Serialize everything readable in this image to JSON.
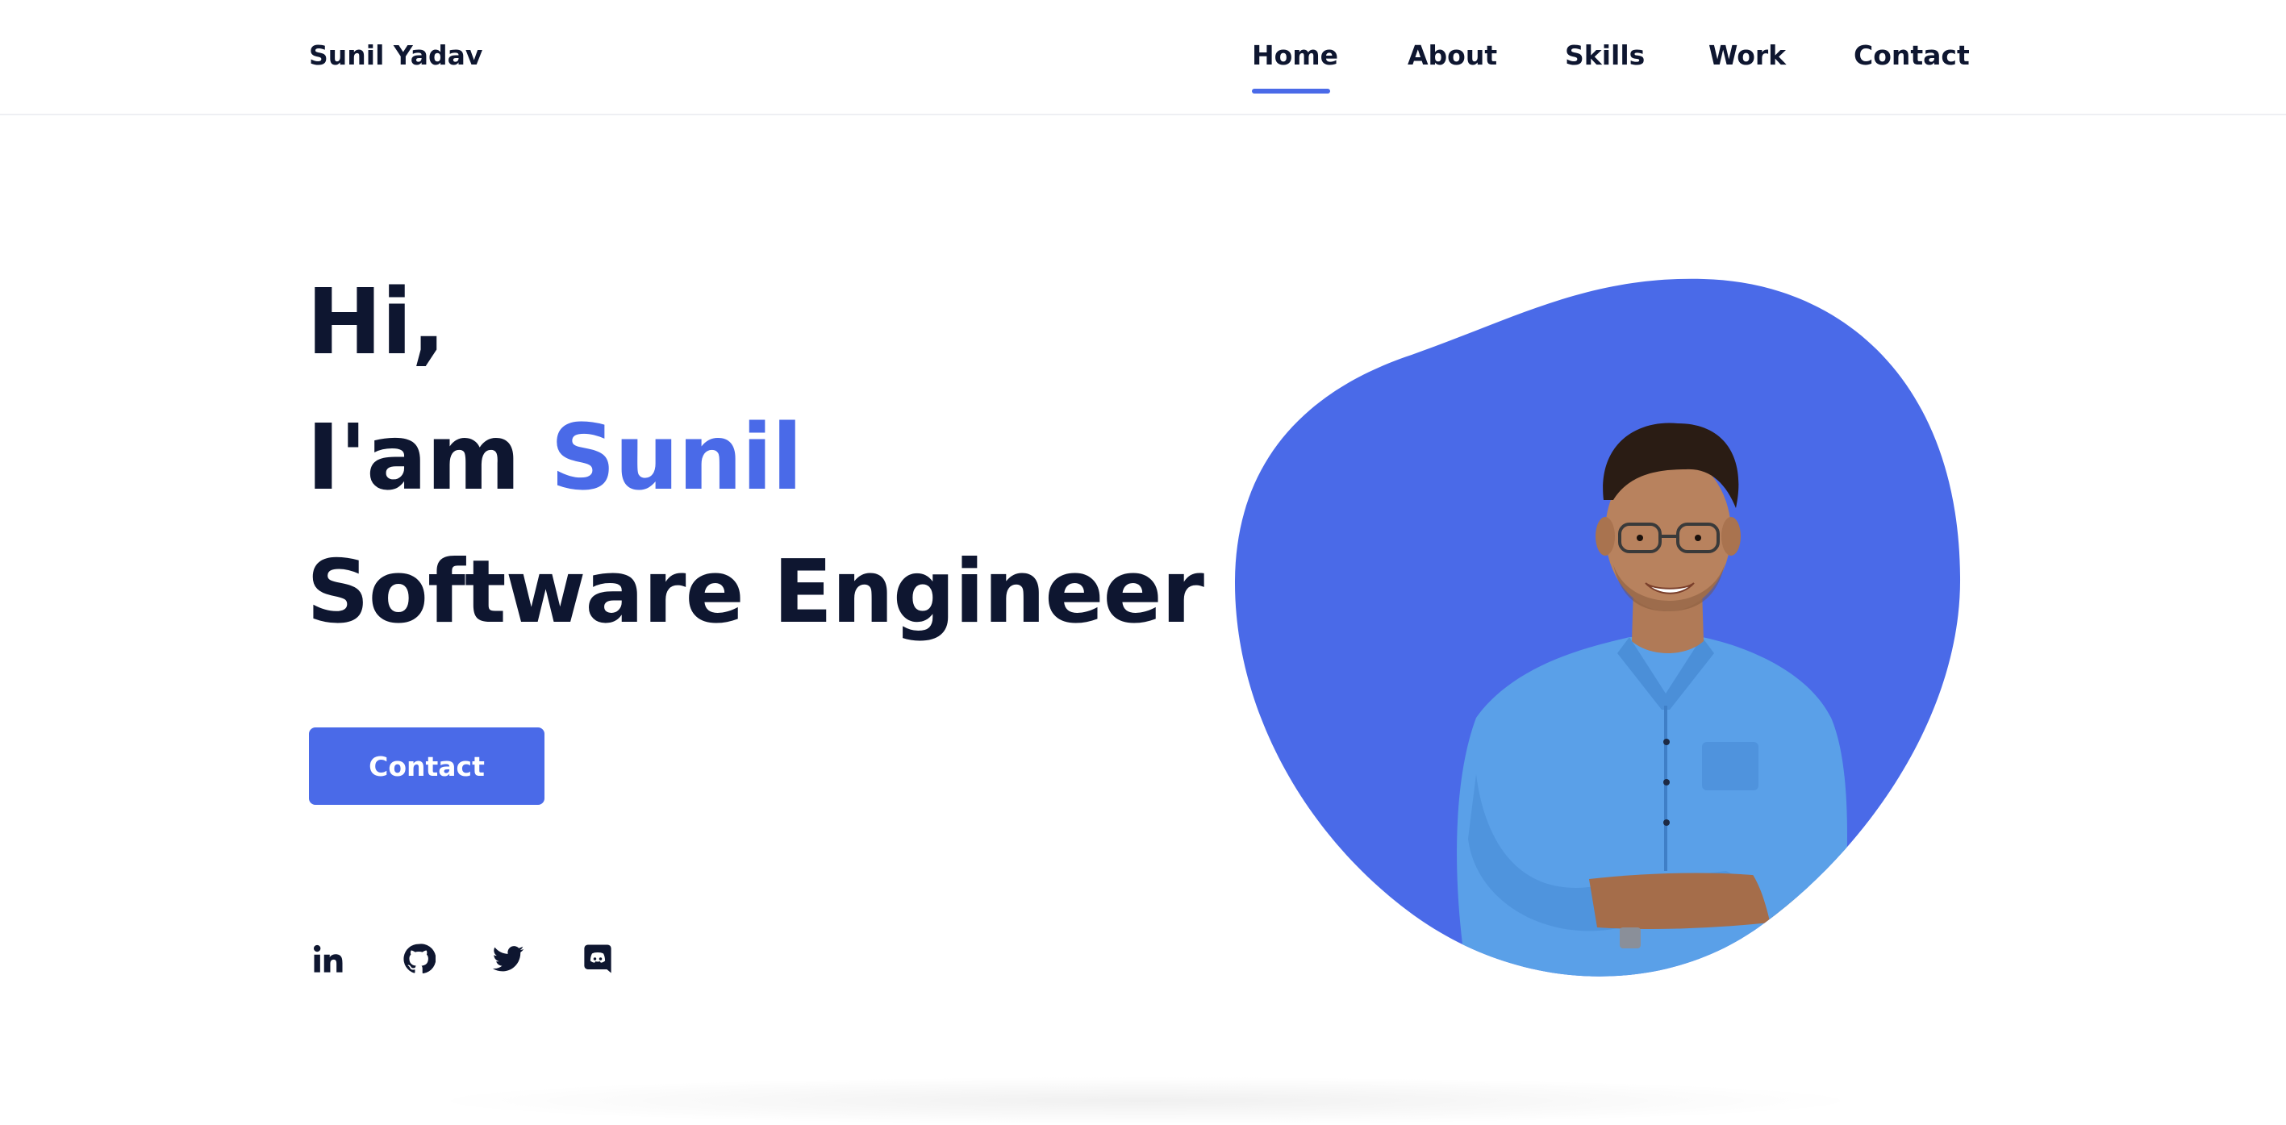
{
  "header": {
    "brand": "Sunil Yadav",
    "nav": [
      {
        "label": "Home",
        "active": true
      },
      {
        "label": "About",
        "active": false
      },
      {
        "label": "Skills",
        "active": false
      },
      {
        "label": "Work",
        "active": false
      },
      {
        "label": "Contact",
        "active": false
      }
    ]
  },
  "hero": {
    "greeting": "Hi,",
    "intro_prefix": "I'am ",
    "intro_name": "Sunil",
    "role": "Software Engineer",
    "cta_label": "Contact"
  },
  "social": [
    {
      "icon": "linkedin-icon"
    },
    {
      "icon": "github-icon"
    },
    {
      "icon": "twitter-icon"
    },
    {
      "icon": "discord-icon"
    }
  ],
  "colors": {
    "accent": "#4a6ae8",
    "text": "#0e1630",
    "background": "#ffffff"
  }
}
